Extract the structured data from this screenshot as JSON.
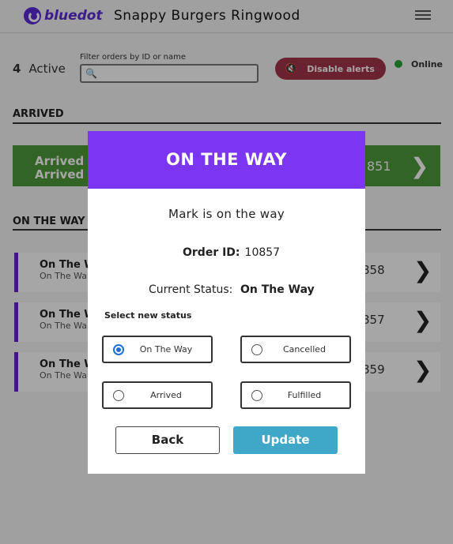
{
  "header": {
    "logo_text": "bluedot",
    "store_title": "Snappy Burgers Ringwood"
  },
  "toolbar": {
    "active_count": "4",
    "active_label": "Active",
    "filter_label": "Filter orders by ID or name",
    "filter_value": "",
    "alerts_button": "Disable alerts",
    "online_label": "Online",
    "online_color": "#2aa33a"
  },
  "sections": {
    "arrived_heading": "ARRIVED",
    "on_the_way_heading": "ON THE WAY"
  },
  "arrived_orders": [
    {
      "line1": "Arrived",
      "line2": "Arrived a",
      "order_id": "851"
    }
  ],
  "on_the_way_orders": [
    {
      "title": "On The W",
      "subtitle": "On The Wa",
      "order_id": "858"
    },
    {
      "title": "On The W",
      "subtitle": "On The Wa",
      "order_id": "857"
    },
    {
      "title": "On The W",
      "subtitle": "On The Wa",
      "order_id": "859"
    }
  ],
  "modal": {
    "title": "ON THE WAY",
    "customer_line": "Mark is on the way",
    "order_id_label": "Order ID:",
    "order_id": "10857",
    "current_status_label": "Current Status:",
    "current_status": "On The Way",
    "select_label": "Select new status",
    "options": [
      {
        "label": "On The Way",
        "selected": true
      },
      {
        "label": "Cancelled",
        "selected": false
      },
      {
        "label": "Arrived",
        "selected": false
      },
      {
        "label": "Fulfilled",
        "selected": false
      }
    ],
    "back_button": "Back",
    "update_button": "Update"
  },
  "colors": {
    "brand": "#5b2bd6",
    "modal_header": "#7c35f0",
    "arrived_green": "#4e9a3a",
    "alerts_red": "#a3344a",
    "update_blue": "#3fa8c9",
    "on_the_way_accent": "#6b22c9"
  }
}
